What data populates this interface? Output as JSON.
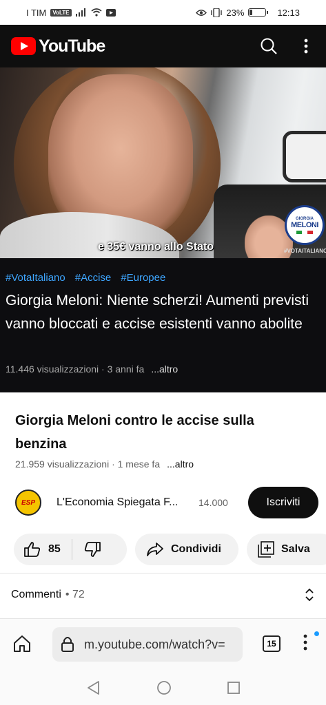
{
  "status_bar": {
    "carrier": "I TIM",
    "volte": "VoLTE",
    "battery_percent": "23%",
    "battery_level": 0.23,
    "time": "12:13"
  },
  "header": {
    "logo_text": "YouTube",
    "brand_color": "#ff0000"
  },
  "video": {
    "caption": "e 35€ vanno allo Stato",
    "badge_top": "GIORGIA",
    "badge_name": "MELONI",
    "watermark": "#VOTAITALIANO",
    "hashtags": [
      "#VotaItaliano",
      "#Accise",
      "#Europee"
    ],
    "title": "Giorgia Meloni: Niente scherzi! Aumenti previsti vanno bloccati e accise esistenti vanno abolite",
    "views": "11.446 visualizzazioni · 3 anni fa",
    "more": "...altro"
  },
  "main": {
    "title": "Giorgia Meloni contro le accise sulla benzina",
    "views": "21.959 visualizzazioni · 1 mese fa",
    "more": "...altro"
  },
  "channel": {
    "avatar_text": "ESP",
    "name": "L'Economia Spiegata F...",
    "subscribers": "14.000",
    "subscribe_label": "Iscriviti"
  },
  "actions": {
    "likes": "85",
    "share_label": "Condividi",
    "save_label": "Salva"
  },
  "comments": {
    "label": "Commenti",
    "count": "• 72"
  },
  "browser": {
    "url": "m.youtube.com/watch?v=",
    "tab_count": "15"
  }
}
